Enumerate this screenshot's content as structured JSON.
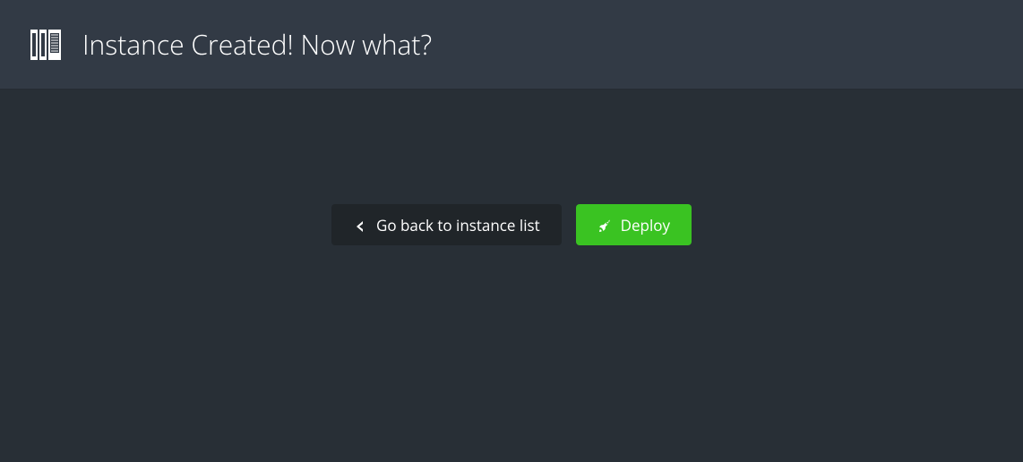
{
  "header": {
    "title": "Instance Created! Now what?",
    "icon": "library-icon"
  },
  "actions": {
    "back_label": "Go back to instance list",
    "deploy_label": "Deploy"
  },
  "colors": {
    "accent_green": "#3ac322",
    "header_bg": "#323a45",
    "body_bg": "#282f36",
    "button_dark_bg": "#202529"
  }
}
